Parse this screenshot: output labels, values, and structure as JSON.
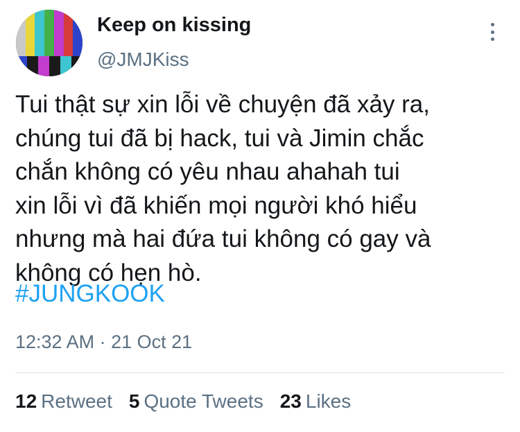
{
  "author": {
    "display_name": "Keep on kissing",
    "handle": "@JMJKiss",
    "avatar_colors": [
      "#c9c9c9",
      "#e8d63a",
      "#3ec6d0",
      "#43b04a",
      "#c23ccd",
      "#d63a3a",
      "#2d44c9"
    ],
    "avatar_bottom_colors": [
      "#2d44c9",
      "#1a1a1a",
      "#c23ccd",
      "#1a1a1a",
      "#3ec6d0",
      "#1a1a1a"
    ]
  },
  "menu": {
    "icon": "more-vertical-icon"
  },
  "tweet": {
    "lines": [
      "Tui thật sự xin lỗi về chuyện đã xảy ra,",
      "chúng tui đã bị hack, tui và Jimin chắc",
      "chắn không có yêu nhau ahahah tui",
      "xin lỗi vì đã khiến mọi người khó hiểu",
      "nhưng mà hai đứa tui không có gay và",
      "không có hẹn hò."
    ],
    "hashtag": "#JUNGKOOK",
    "timestamp": "12:32 AM · 21 Oct 21"
  },
  "stats": {
    "retweets_count": "12",
    "retweets_label": "Retweet",
    "quotes_count": "5",
    "quotes_label": "Quote Tweets",
    "likes_count": "23",
    "likes_label": "Likes"
  },
  "colors": {
    "link": "#1da1f2",
    "secondary_text": "#5b7083",
    "primary_text": "#14171a"
  }
}
